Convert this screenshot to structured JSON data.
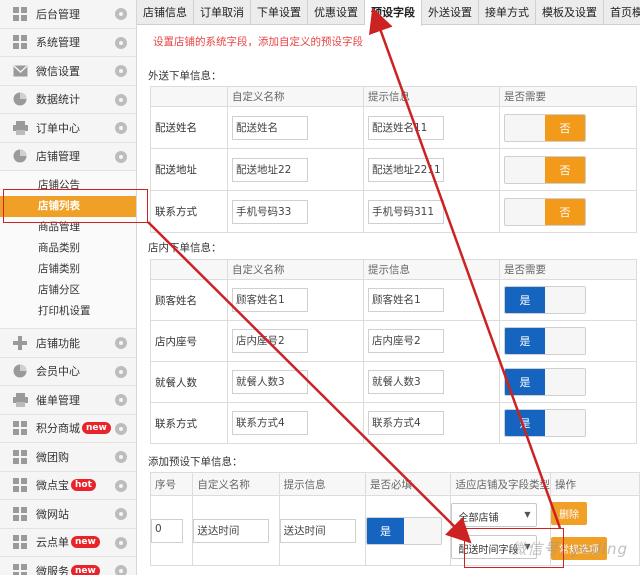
{
  "sidebar": {
    "items_top": [
      {
        "label": "后台管理",
        "icon": "grid-icon"
      },
      {
        "label": "系统管理",
        "icon": "grid-icon"
      },
      {
        "label": "微信设置",
        "icon": "mail-icon"
      },
      {
        "label": "数据统计",
        "icon": "pie-icon"
      },
      {
        "label": "订单中心",
        "icon": "printer-icon"
      },
      {
        "label": "店铺管理",
        "icon": "pie-icon"
      }
    ],
    "sub_items": [
      "店铺公告",
      "店铺列表",
      "商品管理",
      "商品类别",
      "店铺类别",
      "店铺分区",
      "打印机设置"
    ],
    "active_sub": "店铺列表",
    "items_bottom": [
      {
        "label": "店铺功能",
        "icon": "plus-icon",
        "badge": ""
      },
      {
        "label": "会员中心",
        "icon": "pie-icon",
        "badge": ""
      },
      {
        "label": "催单管理",
        "icon": "printer-icon",
        "badge": ""
      },
      {
        "label": "积分商城",
        "icon": "grid-icon",
        "badge": "new"
      },
      {
        "label": "微团购",
        "icon": "grid-icon",
        "badge": ""
      },
      {
        "label": "微点宝",
        "icon": "grid-icon",
        "badge": "hot"
      },
      {
        "label": "微网站",
        "icon": "grid-icon",
        "badge": ""
      },
      {
        "label": "云点单",
        "icon": "grid-icon",
        "badge": "new"
      },
      {
        "label": "微服务",
        "icon": "grid-icon",
        "badge": "new"
      }
    ]
  },
  "tabs": [
    "店铺信息",
    "订单取消",
    "下单设置",
    "优惠设置",
    "预设字段",
    "外送设置",
    "接单方式",
    "模板及设置",
    "首页模块"
  ],
  "active_tab": "预设字段",
  "tip": "设置店铺的系统字段，添加自定义的预设字段",
  "delivery": {
    "title": "外送下单信息：",
    "headers": [
      "",
      "自定义名称",
      "提示信息",
      "是否需要"
    ],
    "rows": [
      {
        "label": "配送姓名",
        "name": "配送姓名",
        "hint": "配送姓名11",
        "required": "否"
      },
      {
        "label": "配送地址",
        "name": "配送地址22",
        "hint": "配送地址2211",
        "required": "否"
      },
      {
        "label": "联系方式",
        "name": "手机号码33",
        "hint": "手机号码311",
        "required": "否"
      }
    ]
  },
  "instore": {
    "title": "店内下单信息：",
    "headers": [
      "",
      "自定义名称",
      "提示信息",
      "是否需要"
    ],
    "rows": [
      {
        "label": "顾客姓名",
        "name": "顾客姓名1",
        "hint": "顾客姓名1",
        "required": "是"
      },
      {
        "label": "店内座号",
        "name": "店内座号2",
        "hint": "店内座号2",
        "required": "是"
      },
      {
        "label": "就餐人数",
        "name": "就餐人数3",
        "hint": "就餐人数3",
        "required": "是"
      },
      {
        "label": "联系方式",
        "name": "联系方式4",
        "hint": "联系方式4",
        "required": "是"
      }
    ]
  },
  "preset": {
    "title": "添加预设下单信息：",
    "headers": [
      "序号",
      "自定义名称",
      "提示信息",
      "是否必填",
      "适应店铺及字段类型",
      "操作"
    ],
    "row": {
      "index": "0",
      "name": "送达时间",
      "hint": "送达时间",
      "required": "是",
      "store": "全部店铺",
      "field_type": "配送时间字段",
      "delete": "删除",
      "extra": "常规选项"
    }
  },
  "watermark": "微信号: yeding",
  "colors": {
    "accent": "#f0a027",
    "blue": "#1565c0",
    "tip": "#e84343",
    "annotation": "#cc2222"
  }
}
